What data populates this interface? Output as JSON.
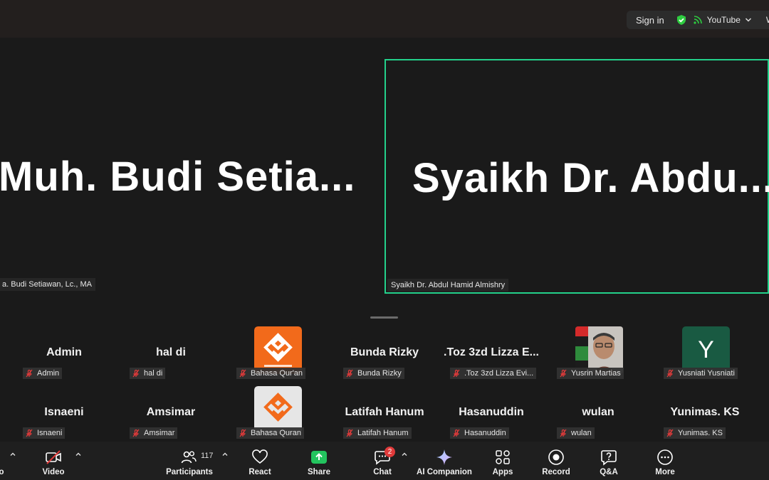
{
  "topbar": {
    "sign_in": "Sign in",
    "channel": "YouTube",
    "truncated": "W"
  },
  "stage": {
    "left_name": "Muh. Budi Setia...",
    "left_tag": "a. Budi Setiawan, Lc., MA",
    "right_name": "Syaikh Dr. Abdu...",
    "right_tag": "Syaikh Dr. Abdul Hamid Almishry"
  },
  "gallery": {
    "row1": [
      {
        "name": "Admin",
        "tag": "Admin"
      },
      {
        "name": "hal di",
        "tag": "hal di"
      },
      {
        "name": "",
        "tag": "Bahasa Qur'an"
      },
      {
        "name": "Bunda Rizky",
        "tag": "Bunda Rizky"
      },
      {
        "name": ".Toz 3zd Lizza E...",
        "tag": ".Toz 3zd Lizza Evi..."
      },
      {
        "name": "",
        "tag": "Yusrin Martias"
      },
      {
        "name": "",
        "tag": "Yusniati Yusniati",
        "avatar": "Y"
      }
    ],
    "row2": [
      {
        "name": "Isnaeni",
        "tag": "Isnaeni"
      },
      {
        "name": "Amsimar",
        "tag": "Amsimar"
      },
      {
        "name": "",
        "tag": "Bahasa Quran"
      },
      {
        "name": "Latifah Hanum",
        "tag": "Latifah Hanum"
      },
      {
        "name": "Hasanuddin",
        "tag": "Hasanuddin"
      },
      {
        "name": "wulan",
        "tag": "wulan"
      },
      {
        "name": "Yunimas. KS",
        "tag": "Yunimas. KS"
      }
    ]
  },
  "toolbar": {
    "audio_partial": "o",
    "video": "Video",
    "participants": "Participants",
    "participants_count": "117",
    "react": "React",
    "share": "Share",
    "chat": "Chat",
    "chat_badge": "2",
    "ai": "AI Companion",
    "apps": "Apps",
    "record": "Record",
    "qa": "Q&A",
    "more": "More"
  },
  "colors": {
    "active_speaker": "#23d18b",
    "share_green": "#23c45e",
    "badge_red": "#e03a3a",
    "avatar_green": "#195a42",
    "logo_orange": "#f26a1b"
  }
}
